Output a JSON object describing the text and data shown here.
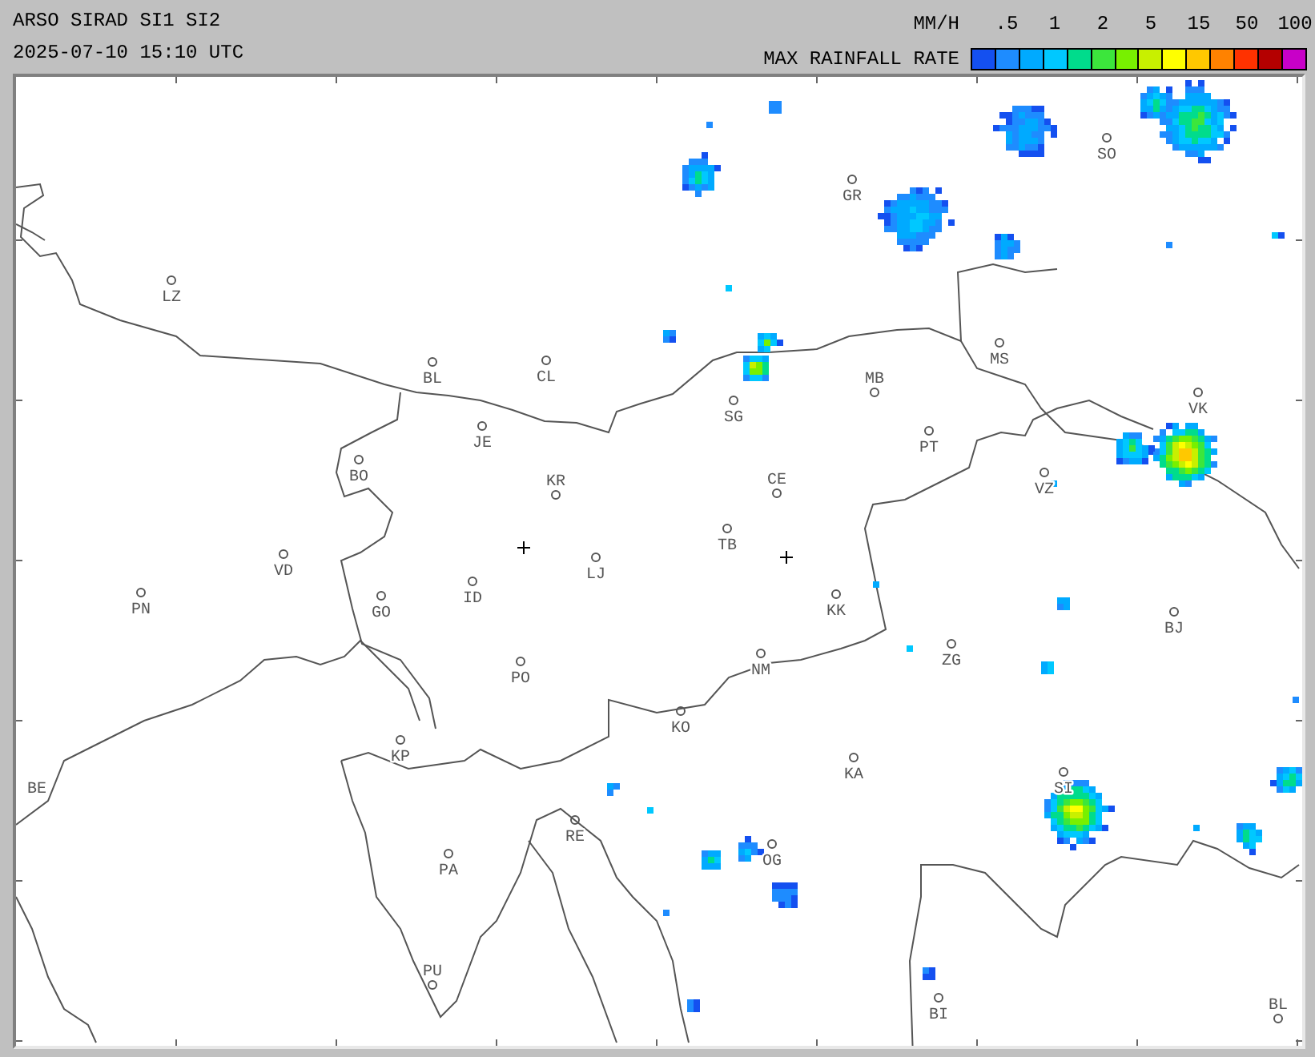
{
  "header": {
    "title": "ARSO SIRAD SI1 SI2",
    "timestamp": "2025-07-10 15:10 UTC"
  },
  "legend": {
    "unit": "MM/H",
    "title": "MAX RAINFALL RATE",
    "ticks": [
      ".5",
      "1",
      "2",
      "5",
      "15",
      "50",
      "100"
    ],
    "bins": [
      {
        "color": "#1450f0"
      },
      {
        "color": "#1e8cff"
      },
      {
        "color": "#00aaff"
      },
      {
        "color": "#00c8ff"
      },
      {
        "color": "#00dc8c"
      },
      {
        "color": "#3ce63c"
      },
      {
        "color": "#78f000"
      },
      {
        "color": "#c8f000"
      },
      {
        "color": "#ffff00"
      },
      {
        "color": "#ffc800"
      },
      {
        "color": "#ff8200"
      },
      {
        "color": "#ff3200"
      },
      {
        "color": "#b40000"
      },
      {
        "color": "#c800c8"
      }
    ]
  },
  "map": {
    "places": [
      {
        "label": "LZ"
      },
      {
        "label": "BL"
      },
      {
        "label": "CL"
      },
      {
        "label": "JE"
      },
      {
        "label": "BO"
      },
      {
        "label": "KR"
      },
      {
        "label": "VD"
      },
      {
        "label": "PN"
      },
      {
        "label": "GO"
      },
      {
        "label": "ID"
      },
      {
        "label": "LJ"
      },
      {
        "label": "PO"
      },
      {
        "label": "KP"
      },
      {
        "label": "BE"
      },
      {
        "label": "PA"
      },
      {
        "label": "PU"
      },
      {
        "label": "RE"
      },
      {
        "label": "GR"
      },
      {
        "label": "SO"
      },
      {
        "label": "SG"
      },
      {
        "label": "MB"
      },
      {
        "label": "MS"
      },
      {
        "label": "PT"
      },
      {
        "label": "CE"
      },
      {
        "label": "TB"
      },
      {
        "label": "VK"
      },
      {
        "label": "VZ"
      },
      {
        "label": "KK"
      },
      {
        "label": "BJ"
      },
      {
        "label": "ZG"
      },
      {
        "label": "NM"
      },
      {
        "label": "KO"
      },
      {
        "label": "KA"
      },
      {
        "label": "OG"
      },
      {
        "label": "SI"
      },
      {
        "label": "BI"
      },
      {
        "label": "BL"
      }
    ]
  }
}
